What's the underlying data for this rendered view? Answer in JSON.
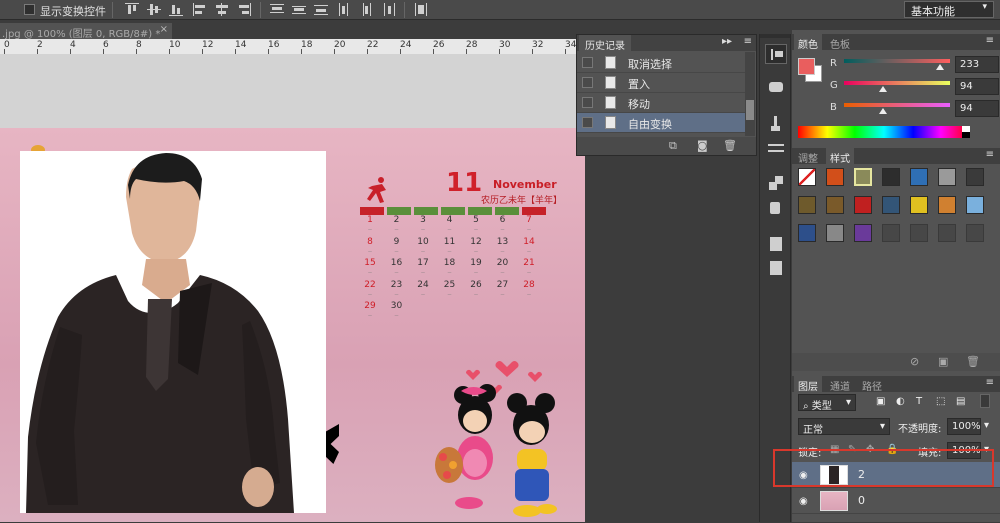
{
  "options_bar": {
    "show_transform_controls_label": "显示变换控件",
    "workspace": "基本功能"
  },
  "document": {
    "tab_title": ".jpg @ 100% (图层 0, RGB/8#) *",
    "close_glyph": "×",
    "ruler_marks": [
      "0",
      "2",
      "4",
      "6",
      "8",
      "10",
      "12",
      "14",
      "16",
      "18",
      "20",
      "22",
      "24",
      "26",
      "28",
      "30",
      "32",
      "34"
    ]
  },
  "calendar": {
    "month_number": "11",
    "month_name": "November",
    "lunar_label": "农历乙未年【羊年】",
    "weekday_colors": [
      "#c62128",
      "#5a8f3a",
      "#5a8f3a",
      "#5a8f3a",
      "#5a8f3a",
      "#5a8f3a",
      "#c62128"
    ],
    "weeks": [
      [
        "1",
        "2",
        "3",
        "4",
        "5",
        "6",
        "7"
      ],
      [
        "8",
        "9",
        "10",
        "11",
        "12",
        "13",
        "14"
      ],
      [
        "15",
        "16",
        "17",
        "18",
        "19",
        "20",
        "21"
      ],
      [
        "22",
        "23",
        "24",
        "25",
        "26",
        "27",
        "28"
      ],
      [
        "29",
        "30",
        "",
        "",
        "",
        "",
        ""
      ]
    ]
  },
  "history_panel": {
    "tab_label": "历史记录",
    "collapse_glyph": "▸▸",
    "menu_glyph": "≡",
    "items": [
      {
        "label": "取消选择",
        "selected": false
      },
      {
        "label": "置入",
        "selected": false
      },
      {
        "label": "移动",
        "selected": false
      },
      {
        "label": "自由变换",
        "selected": true
      }
    ]
  },
  "color_panel": {
    "tabs": [
      "颜色",
      "色板"
    ],
    "foreground": "#e95e5e",
    "channels": [
      {
        "name": "R",
        "value": "233",
        "level": 0.91
      },
      {
        "name": "G",
        "value": "94",
        "level": 0.37
      },
      {
        "name": "B",
        "value": "94",
        "level": 0.37
      }
    ]
  },
  "styles_panel": {
    "tabs": [
      "调整",
      "样式"
    ],
    "swatch_colors": [
      "#ffffff",
      "#d24f1a",
      "#8a8a5a",
      "#2d2d2d",
      "#2f6fb5",
      "#9a9a9a",
      "#3a3a3a",
      "#6e5a2c",
      "#7a5a2a",
      "#c02020",
      "#335577",
      "#e0c020",
      "#d08030",
      "#7ab0dd",
      "#2d4f8a",
      "#888888",
      "#6a3a9a"
    ]
  },
  "layers_panel": {
    "tabs": [
      "图层",
      "通道",
      "路径"
    ],
    "filter_kind": "类型",
    "blend_mode": "正常",
    "opacity_label": "不透明度:",
    "opacity_value": "100%",
    "lock_label": "锁定:",
    "fill_label": "填充:",
    "fill_value": "100%",
    "layers": [
      {
        "name": "2",
        "selected": true
      },
      {
        "name": "0",
        "selected": false
      }
    ]
  }
}
